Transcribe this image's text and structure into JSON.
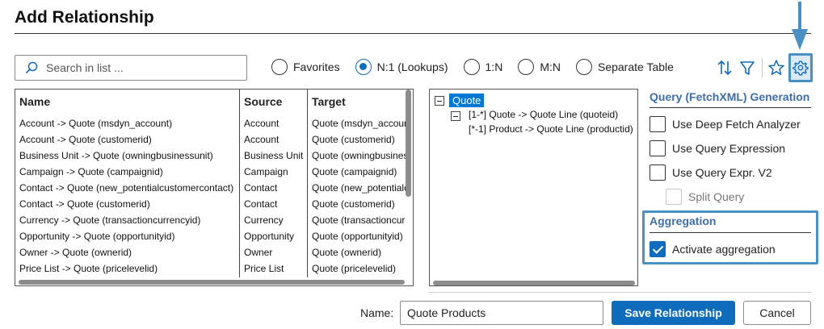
{
  "dialog": {
    "title": "Add Relationship"
  },
  "search": {
    "placeholder": "Search in list ..."
  },
  "filters": [
    {
      "label": "Favorites",
      "selected": false
    },
    {
      "label": "N:1 (Lookups)",
      "selected": true
    },
    {
      "label": "1:N",
      "selected": false
    },
    {
      "label": "M:N",
      "selected": false
    },
    {
      "label": "Separate Table",
      "selected": false
    }
  ],
  "toolbar_icons": [
    "sort-icon",
    "filter-icon",
    "favorite-star-icon",
    "gear-icon"
  ],
  "grid": {
    "headers": {
      "name": "Name",
      "source": "Source",
      "target": "Target"
    },
    "rows": [
      {
        "name": "Account -> Quote (msdyn_account)",
        "source": "Account",
        "target": "Quote (msdyn_account)"
      },
      {
        "name": "Account -> Quote (customerid)",
        "source": "Account",
        "target": "Quote (customerid)"
      },
      {
        "name": "Business Unit -> Quote (owningbusinessunit)",
        "source": "Business Unit",
        "target": "Quote (owningbusinessunit)"
      },
      {
        "name": "Campaign -> Quote (campaignid)",
        "source": "Campaign",
        "target": "Quote (campaignid)"
      },
      {
        "name": "Contact -> Quote (new_potentialcustomercontact)",
        "source": "Contact",
        "target": "Quote (new_potentialcustomercontact)"
      },
      {
        "name": "Contact -> Quote (customerid)",
        "source": "Contact",
        "target": "Quote (customerid)"
      },
      {
        "name": "Currency -> Quote (transactioncurrencyid)",
        "source": "Currency",
        "target": "Quote (transactioncurrencyid)"
      },
      {
        "name": "Opportunity -> Quote (opportunityid)",
        "source": "Opportunity",
        "target": "Quote (opportunityid)"
      },
      {
        "name": "Owner -> Quote (ownerid)",
        "source": "Owner",
        "target": "Quote (ownerid)"
      },
      {
        "name": "Price List -> Quote (pricelevelid)",
        "source": "Price List",
        "target": "Quote (pricelevelid)"
      }
    ]
  },
  "tree": {
    "root": "Quote",
    "children": [
      "[1-*] Quote -> Quote Line (quoteid)",
      "[*-1] Product -> Quote Line (productid)"
    ]
  },
  "options": {
    "title": "Query (FetchXML) Generation",
    "deep_fetch": {
      "label": "Use Deep Fetch Analyzer",
      "checked": false
    },
    "query_expr": {
      "label": "Use Query Expression",
      "checked": false
    },
    "query_expr_v2": {
      "label": "Use Query Expr. V2",
      "checked": false
    },
    "split_query": {
      "label": "Split Query",
      "checked": false,
      "disabled": true
    }
  },
  "aggregation": {
    "title": "Aggregation",
    "activate": {
      "label": "Activate aggregation",
      "checked": true
    }
  },
  "footer": {
    "name_label": "Name:",
    "name_value": "Quote Products",
    "save_label": "Save Relationship",
    "cancel_label": "Cancel"
  },
  "colors": {
    "accent": "#0f6cbd",
    "highlight_border": "#4a90c2",
    "section_title": "#3d6ea8"
  }
}
